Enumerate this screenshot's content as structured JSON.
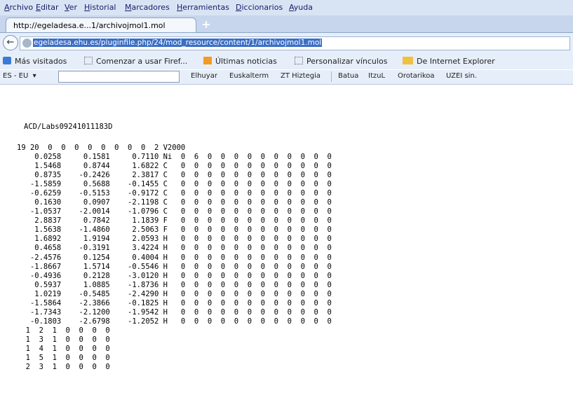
{
  "menu": [
    "Archivo",
    "Editar",
    "Ver",
    "Historial",
    "Marcadores",
    "Herramientas",
    "Diccionarios",
    "Ayuda"
  ],
  "tab": {
    "title": "http://egeladesa.e...1/archivojmol1.mol",
    "new_tab": "+"
  },
  "url": "egeladesa.ehu.es/pluginfile.php/24/mod_resource/content/1/archivojmol1.mol",
  "bookmarks": [
    "Más visitados",
    "Comenzar a usar Firef...",
    "Últimas noticias",
    "Personalizar vínculos",
    "De Internet Explorer"
  ],
  "dict_toolbar": {
    "lang": "ES - EU",
    "arrow": "▾",
    "search_value": "",
    "links": [
      "Elhuyar",
      "Euskalterm",
      "ZT Hiztegia",
      "Batua",
      "ItzuL",
      "Orotarikoa",
      "UZEI sin."
    ]
  },
  "file": {
    "header": "ACD/Labs09241011183D",
    "counts": "19 20  0  0  0  0  0  0  0  0  2 V2000",
    "atoms": [
      "    0.0258     0.1581     0.7110 Ni  0  6  0  0  0  0  0  0  0  0  0  0",
      "    1.5468     0.8744     1.6822 C   0  0  0  0  0  0  0  0  0  0  0  0",
      "    0.8735    -0.2426     2.3817 C   0  0  0  0  0  0  0  0  0  0  0  0",
      "   -1.5859     0.5688    -0.1455 C   0  0  0  0  0  0  0  0  0  0  0  0",
      "   -0.6259    -0.5153    -0.9172 C   0  0  0  0  0  0  0  0  0  0  0  0",
      "    0.1630     0.0907    -2.1198 C   0  0  0  0  0  0  0  0  0  0  0  0",
      "   -1.0537    -2.0014    -1.0796 C   0  0  0  0  0  0  0  0  0  0  0  0",
      "    2.8837     0.7842     1.1839 F   0  0  0  0  0  0  0  0  0  0  0  0",
      "    1.5638    -1.4860     2.5063 F   0  0  0  0  0  0  0  0  0  0  0  0",
      "    1.6892     1.9194     2.0593 H   0  0  0  0  0  0  0  0  0  0  0  0",
      "    0.4658    -0.3191     3.4224 H   0  0  0  0  0  0  0  0  0  0  0  0",
      "   -2.4576     0.1254     0.4004 H   0  0  0  0  0  0  0  0  0  0  0  0",
      "   -1.8667     1.5714    -0.5546 H   0  0  0  0  0  0  0  0  0  0  0  0",
      "   -0.4936     0.2128    -3.0120 H   0  0  0  0  0  0  0  0  0  0  0  0",
      "    0.5937     1.0885    -1.8736 H   0  0  0  0  0  0  0  0  0  0  0  0",
      "    1.0219    -0.5485    -2.4290 H   0  0  0  0  0  0  0  0  0  0  0  0",
      "   -1.5864    -2.3866    -0.1825 H   0  0  0  0  0  0  0  0  0  0  0  0",
      "   -1.7343    -2.1200    -1.9542 H   0  0  0  0  0  0  0  0  0  0  0  0",
      "   -0.1803    -2.6798    -1.2052 H   0  0  0  0  0  0  0  0  0  0  0  0"
    ],
    "bonds": [
      "  1  2  1  0  0  0  0",
      "  1  3  1  0  0  0  0",
      "  1  4  1  0  0  0  0",
      "  1  5  1  0  0  0  0",
      "  2  3  1  0  0  0  0"
    ]
  }
}
